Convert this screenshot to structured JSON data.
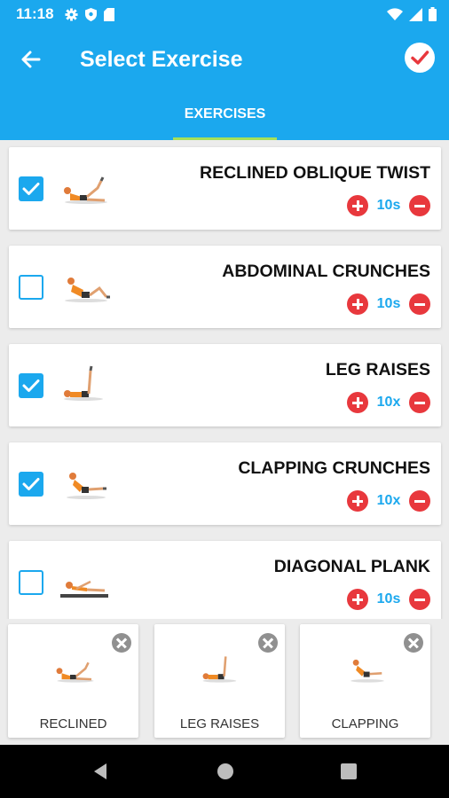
{
  "status_bar": {
    "time": "11:18",
    "left_icons": [
      "gear-icon",
      "shield-icon",
      "sd-card-icon"
    ],
    "right_icons": [
      "wifi-icon",
      "signal-icon",
      "battery-icon"
    ]
  },
  "app_bar": {
    "title": "Select Exercise",
    "back_icon": "arrow-left-icon",
    "confirm_icon": "check-circle-icon",
    "tab": "EXERCISES"
  },
  "exercises": [
    {
      "name": "RECLINED OBLIQUE TWIST",
      "amount": "10s",
      "checked": true
    },
    {
      "name": "ABDOMINAL CRUNCHES",
      "amount": "10s",
      "checked": false
    },
    {
      "name": "LEG RAISES",
      "amount": "10x",
      "checked": true
    },
    {
      "name": "CLAPPING CRUNCHES",
      "amount": "10x",
      "checked": true
    },
    {
      "name": "DIAGONAL PLANK",
      "amount": "10s",
      "checked": false
    }
  ],
  "selected": [
    {
      "label": "RECLINED"
    },
    {
      "label": "LEG RAISES"
    },
    {
      "label": "CLAPPING"
    }
  ],
  "colors": {
    "primary": "#1ba8ee",
    "accent_red": "#e8383d",
    "tab_indicator": "#a6e05a"
  },
  "nav_bar": [
    "back-triangle-icon",
    "home-circle-icon",
    "recents-square-icon"
  ]
}
